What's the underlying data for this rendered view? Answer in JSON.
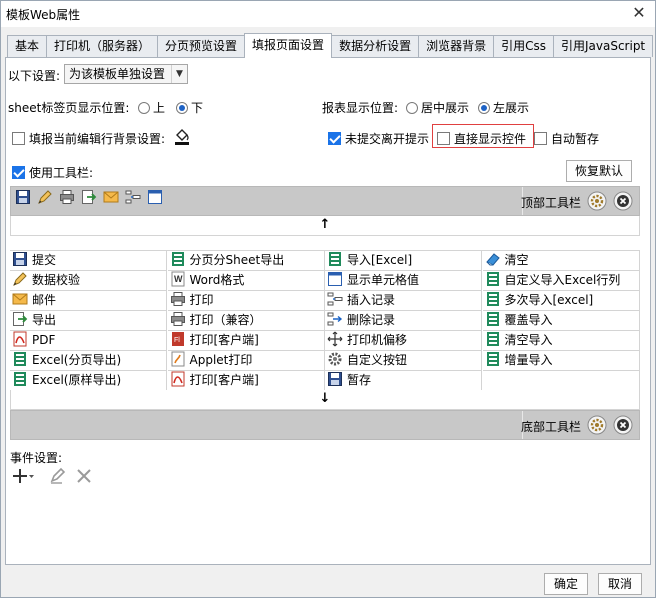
{
  "window": {
    "title": "模板Web属性",
    "close_symbol": "✕"
  },
  "tabs": [
    {
      "label": "基本",
      "active": false
    },
    {
      "label": "打印机（服务器）",
      "active": false
    },
    {
      "label": "分页预览设置",
      "active": false
    },
    {
      "label": "填报页面设置",
      "active": true
    },
    {
      "label": "数据分析设置",
      "active": false
    },
    {
      "label": "浏览器背景",
      "active": false
    },
    {
      "label": "引用Css",
      "active": false
    },
    {
      "label": "引用JavaScript",
      "active": false
    }
  ],
  "settings": {
    "scope_label": "以下设置:",
    "scope_value": "为该模板单独设置",
    "sheet_pos_label": "sheet标签页显示位置:",
    "sheet_pos_options": [
      {
        "label": "上",
        "selected": false
      },
      {
        "label": "下",
        "selected": true
      }
    ],
    "report_pos_label": "报表显示位置:",
    "report_pos_options": [
      {
        "label": "居中展示",
        "selected": false
      },
      {
        "label": "左展示",
        "selected": true
      }
    ],
    "fill_bg_label": "填报当前编辑行背景设置:",
    "fill_bg_checked": false,
    "unsubmitted_label": "未提交离开提示",
    "unsubmitted_checked": true,
    "direct_show_label": "直接显示控件",
    "direct_show_checked": false,
    "autosave_label": "自动暂存",
    "autosave_checked": false,
    "use_toolbar_label": "使用工具栏:",
    "use_toolbar_checked": true,
    "restore_default_label": "恢复默认"
  },
  "top_toolbar": {
    "label": "顶部工具栏",
    "icons": [
      "save-icon",
      "edit-check-icon",
      "print-icon",
      "export-icon",
      "mail-icon",
      "insert-record-icon",
      "cell-format-icon"
    ]
  },
  "bottom_toolbar": {
    "label": "底部工具栏"
  },
  "arrows": {
    "up": "↑",
    "down": "↓"
  },
  "buttons": [
    {
      "label": "提交",
      "icon": "save-icon"
    },
    {
      "label": "分页分Sheet导出",
      "icon": "excel-icon"
    },
    {
      "label": "导入[Excel]",
      "icon": "excel-icon"
    },
    {
      "label": "清空",
      "icon": "eraser-icon"
    },
    {
      "label": "数据校验",
      "icon": "edit-check-icon"
    },
    {
      "label": "Word格式",
      "icon": "word-icon"
    },
    {
      "label": "显示单元格值",
      "icon": "cell-format-icon"
    },
    {
      "label": "自定义导入Excel行列",
      "icon": "excel-icon"
    },
    {
      "label": "邮件",
      "icon": "mail-icon"
    },
    {
      "label": "打印",
      "icon": "print-icon"
    },
    {
      "label": "插入记录",
      "icon": "insert-record-icon"
    },
    {
      "label": "多次导入[excel]",
      "icon": "excel-icon"
    },
    {
      "label": "导出",
      "icon": "export-icon"
    },
    {
      "label": "打印（兼容）",
      "icon": "print-icon"
    },
    {
      "label": "删除记录",
      "icon": "delete-record-icon"
    },
    {
      "label": "覆盖导入",
      "icon": "excel-icon"
    },
    {
      "label": "PDF",
      "icon": "pdf-icon"
    },
    {
      "label": "打印[客户端]",
      "icon": "flash-print-icon"
    },
    {
      "label": "打印机偏移",
      "icon": "printer-offset-icon"
    },
    {
      "label": "清空导入",
      "icon": "excel-icon"
    },
    {
      "label": "Excel(分页导出)",
      "icon": "excel-icon"
    },
    {
      "label": "Applet打印",
      "icon": "applet-print-icon"
    },
    {
      "label": "自定义按钮",
      "icon": "gear-icon"
    },
    {
      "label": "增量导入",
      "icon": "excel-icon"
    },
    {
      "label": "Excel(原样导出)",
      "icon": "excel-icon"
    },
    {
      "label": "打印[客户端]",
      "icon": "pdf-icon"
    },
    {
      "label": "暂存",
      "icon": "save-icon"
    },
    {
      "label": "",
      "icon": ""
    }
  ],
  "events": {
    "label": "事件设置:"
  },
  "footer": {
    "ok": "确定",
    "cancel": "取消"
  },
  "colors": {
    "accent": "#1a73e8",
    "highlight_border": "#e04040",
    "toolbar_strip": "#c8c8c8"
  }
}
